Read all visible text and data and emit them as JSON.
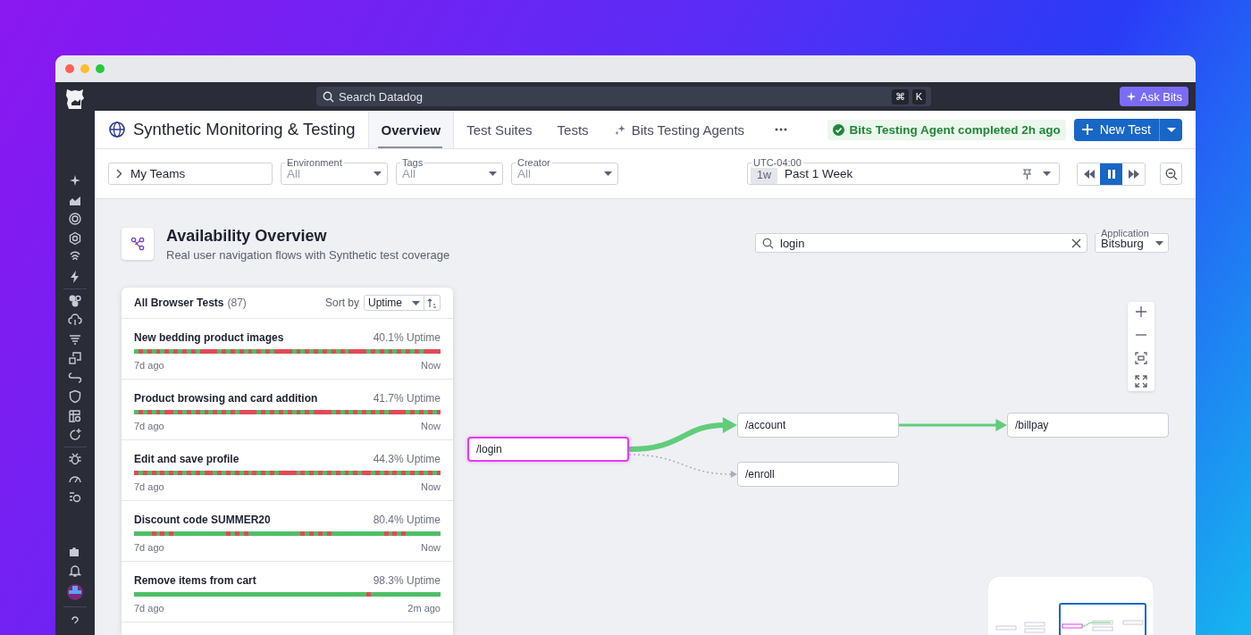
{
  "topbar": {
    "search_placeholder": "Search Datadog",
    "shortcut_keys": [
      "⌘",
      "K"
    ],
    "ask_button": "Ask Bits"
  },
  "header": {
    "title": "Synthetic Monitoring & Testing",
    "tabs": [
      {
        "label": "Overview",
        "selected": true,
        "kind": "plain"
      },
      {
        "label": "Test Suites",
        "selected": false,
        "kind": "plain"
      },
      {
        "label": "Tests",
        "selected": false,
        "kind": "plain"
      },
      {
        "label": "Bits Testing Agents",
        "selected": false,
        "kind": "ai"
      }
    ],
    "status": "Bits Testing Agent completed 2h ago",
    "new_button": "New Test"
  },
  "filters": {
    "teams": "My Teams",
    "dropdowns": [
      {
        "label": "Environment",
        "value": "All"
      },
      {
        "label": "Tags",
        "value": "All"
      },
      {
        "label": "Creator",
        "value": "All"
      }
    ],
    "time": {
      "timezone": "UTC-04:00",
      "chip": "1w",
      "range": "Past 1 Week"
    },
    "playback_buttons": [
      {
        "kind": "rewind",
        "selected": false
      },
      {
        "kind": "pause",
        "selected": true
      },
      {
        "kind": "forward",
        "selected": false
      }
    ]
  },
  "overview": {
    "title": "Availability Overview",
    "subtitle": "Real user navigation flows with Synthetic test coverage",
    "search": {
      "value": "login"
    },
    "application": {
      "label": "Application",
      "value": "Bitsburg"
    }
  },
  "test_list": {
    "title": "All Browser Tests",
    "count": "(87)",
    "sort_label": "Sort by",
    "sort_value": "Uptime",
    "rows": [
      {
        "name": "New bedding product images",
        "uptime": "40.1% Uptime",
        "level": 0.401,
        "start": "7d ago",
        "end": "Now"
      },
      {
        "name": "Product browsing and card addition",
        "uptime": "41.7% Uptime",
        "level": 0.417,
        "start": "7d ago",
        "end": "Now"
      },
      {
        "name": "Edit and save profile",
        "uptime": "44.3% Uptime",
        "level": 0.443,
        "start": "7d ago",
        "end": "Now"
      },
      {
        "name": "Discount code SUMMER20",
        "uptime": "80.4% Uptime",
        "level": 0.804,
        "start": "7d ago",
        "end": "Now"
      },
      {
        "name": "Remove items from cart",
        "uptime": "98.3% Uptime",
        "level": 0.983,
        "start": "7d ago",
        "end": "2m ago"
      }
    ]
  },
  "flow": {
    "nodes": [
      {
        "label": "/login",
        "selected": true,
        "children": [
          {
            "label": "/account",
            "selected": false,
            "kind": "thick",
            "children": [
              {
                "label": "/billpay",
                "selected": false,
                "kind": "thin"
              }
            ]
          },
          {
            "label": "/enroll",
            "selected": false,
            "kind": "dotted"
          }
        ]
      }
    ]
  }
}
